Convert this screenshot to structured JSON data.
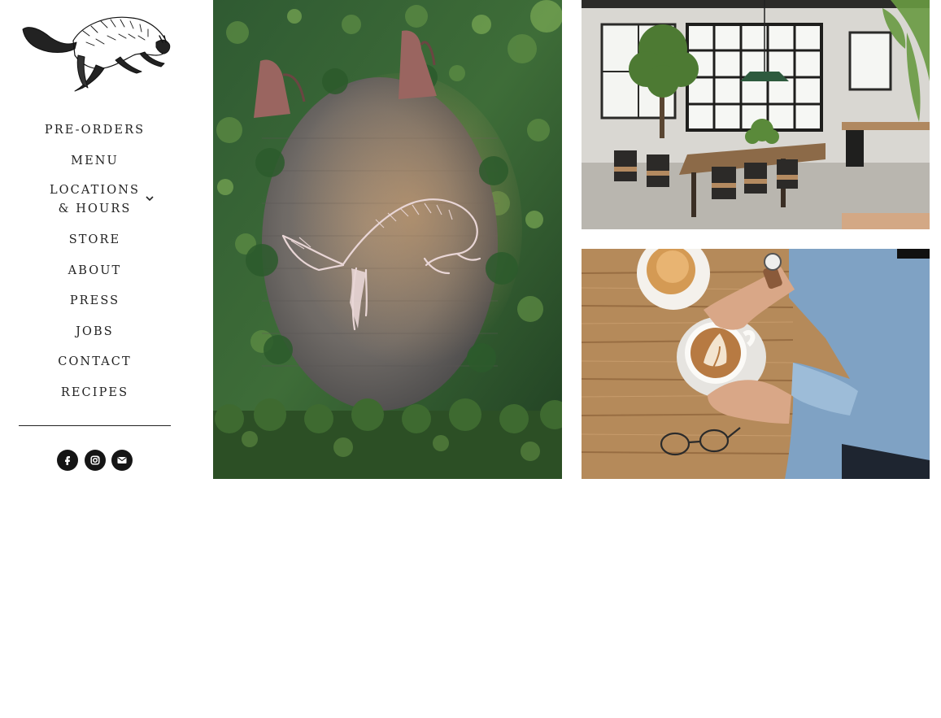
{
  "brand": {
    "logo_icon": "leaping-fox-logo"
  },
  "nav": {
    "items": [
      {
        "label": "PRE-ORDERS"
      },
      {
        "label": "MENU"
      },
      {
        "label": "LOCATIONS & HOURS",
        "has_submenu": true,
        "submenu_icon": "chevron-down-icon"
      },
      {
        "label": "STORE"
      },
      {
        "label": "ABOUT"
      },
      {
        "label": "PRESS"
      },
      {
        "label": "JOBS"
      },
      {
        "label": "CONTACT"
      },
      {
        "label": "RECIPES"
      }
    ]
  },
  "social": {
    "links": [
      {
        "icon": "facebook-icon"
      },
      {
        "icon": "instagram-icon"
      },
      {
        "icon": "email-icon"
      }
    ]
  },
  "gallery": {
    "images": [
      {
        "subject": "fox-mural-on-ivy-wall"
      },
      {
        "subject": "cafe-interior-with-tables"
      },
      {
        "subject": "latte-and-pastry-on-wooden-table"
      }
    ]
  },
  "colors": {
    "text": "#222222",
    "icon_bg": "#151515",
    "background": "#ffffff"
  }
}
